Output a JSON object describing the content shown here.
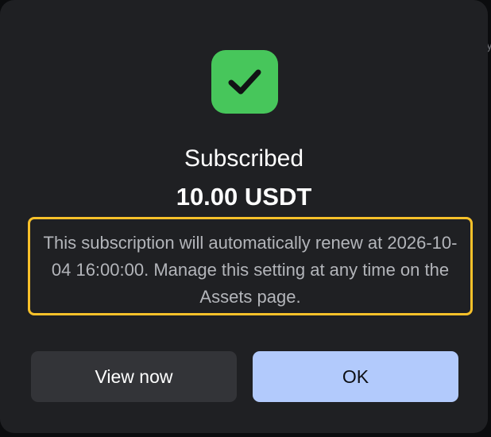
{
  "dialog": {
    "status_icon": "check-icon",
    "title": "Subscribed",
    "amount": "10.00 USDT",
    "notice": "This subscription will automatically renew at 2026-10-04 16:00:00. Manage this setting at any time on the Assets page.",
    "buttons": {
      "view_now_label": "View now",
      "ok_label": "OK"
    }
  },
  "background": {
    "edge_text": "y"
  },
  "colors": {
    "success": "#47c65b",
    "highlight_border": "#f8c12a",
    "primary_button": "#b2cafc",
    "secondary_button": "#333438",
    "dialog_bg": "#1f2023"
  }
}
